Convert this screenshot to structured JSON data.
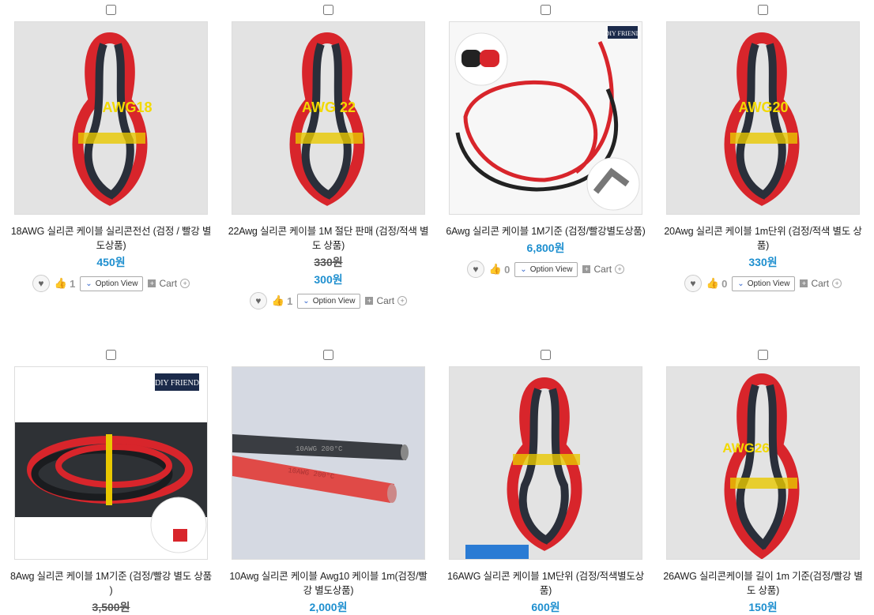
{
  "products": [
    {
      "name": "18AWG 실리콘 케이블 실리콘전선 (검정 / 빨강 별도상품)",
      "price": "450원",
      "orig": "",
      "likes": "1",
      "img_label": "AWG18",
      "img_style": "coil"
    },
    {
      "name": "22Awg 실리콘 케이블 1M 절단 판매 (검정/적색 별도 상품)",
      "price": "300원",
      "orig": "330원",
      "likes": "1",
      "img_label": "AWG 22",
      "img_style": "coil"
    },
    {
      "name": "6Awg 실리콘 케이블 1M기준 (검정/빨강별도상품)",
      "price": "6,800원",
      "orig": "",
      "likes": "0",
      "img_label": "",
      "img_style": "loop",
      "logo": "DIY FRIEND"
    },
    {
      "name": "20Awg 실리콘 케이블 1m단위 (검정/적색 별도 상품)",
      "price": "330원",
      "orig": "",
      "likes": "0",
      "img_label": "AWG20",
      "img_style": "coil"
    },
    {
      "name": "8Awg 실리콘 케이블 1M기준 (검정/빨강 별도 상품 )",
      "price": "",
      "orig": "3,500원",
      "likes": "",
      "img_label": "",
      "img_style": "bundle",
      "logo": "DIY FRIEND"
    },
    {
      "name": "10Awg 실리콘 케이블 Awg10 케이블 1m(검정/빨강 별도상품)",
      "price": "2,000원",
      "orig": "",
      "likes": "",
      "img_label": "",
      "img_style": "straight",
      "wire_text": "10AWG 200°C"
    },
    {
      "name": "16AWG 실리콘 케이블 1M단위 (검정/적색별도상품)",
      "price": "600원",
      "orig": "",
      "likes": "",
      "img_label": "",
      "img_style": "coil"
    },
    {
      "name": "26AWG 실리콘케이블 길이 1m 기준(검정/빨강 별도 상품)",
      "price": "150원",
      "orig": "",
      "likes": "",
      "img_label": "AWG26",
      "img_style": "coil"
    }
  ],
  "ui": {
    "option_view": "Option View",
    "cart": "Cart"
  },
  "colors": {
    "price": "#1e8fcf",
    "wire_red": "#d8252b",
    "wire_black": "#2a2f3a",
    "tie_yellow": "#e8c800"
  }
}
